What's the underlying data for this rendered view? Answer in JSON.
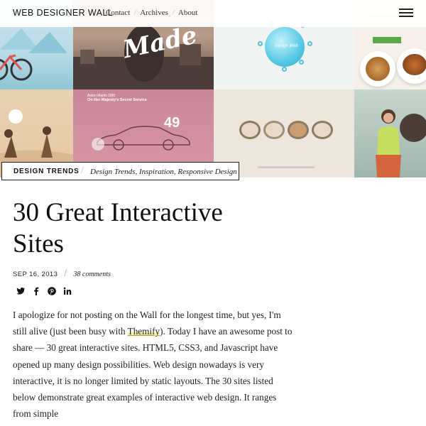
{
  "header": {
    "logo": "WEB DESIGNER WALL",
    "nav": [
      {
        "label": "Contact"
      },
      {
        "label": "Archives"
      },
      {
        "label": "About"
      }
    ],
    "separator": "/",
    "menu_icon": "hamburger-menu-icon"
  },
  "hero": {
    "tiles": [
      {
        "name": "bicycle-illustration",
        "color": "#b7dbe7"
      },
      {
        "name": "made-portrait",
        "text": "Made",
        "color": "#9e8a7a"
      },
      {
        "name": "bubble-interface",
        "bubble_text": "Design Web",
        "color": "#56c9e3"
      },
      {
        "name": "food-site",
        "color": "#5aa84a"
      },
      {
        "name": "beach-illustration",
        "color": "#e6c7a1"
      },
      {
        "name": "car-site",
        "number": "49",
        "header_line1": "Aston Martin DB5",
        "header_line2": "On Her Majesty's Secret Service",
        "color": "#c9869a"
      },
      {
        "name": "ring-products",
        "color": "#ece6dc"
      },
      {
        "name": "coffee-woman",
        "color": "#9fb6ad"
      }
    ]
  },
  "category": {
    "name": "DESIGN TRENDS",
    "tags": "Design Trends, Inspiration, Responsive Design"
  },
  "article": {
    "title_line1": "30 Great Interactive",
    "title_line2": "Sites",
    "date": "SEP 16, 2013",
    "comments": "38 comments",
    "share": [
      {
        "icon": "twitter-icon"
      },
      {
        "icon": "facebook-icon"
      },
      {
        "icon": "pinterest-icon"
      },
      {
        "icon": "linkedin-icon"
      }
    ],
    "body_before_link": "I apologize for not posting on the Wall for the longest time, but yes, I'm still alive (just been busy with ",
    "body_link": "Themify",
    "body_after_link": "). Today I have an awesome post to share — 30 great interactive sites. HTML5, CSS3, and Javascript have opened up many design possibilities. Web design nowadays is very interactive, it is no longer limited by static layouts. The 30 sites listed below demonstrate great examples of interactive web design. It ranges from simple"
  },
  "colors": {
    "text": "#222222",
    "highlight": "#fff3a6",
    "border": "#222222"
  }
}
